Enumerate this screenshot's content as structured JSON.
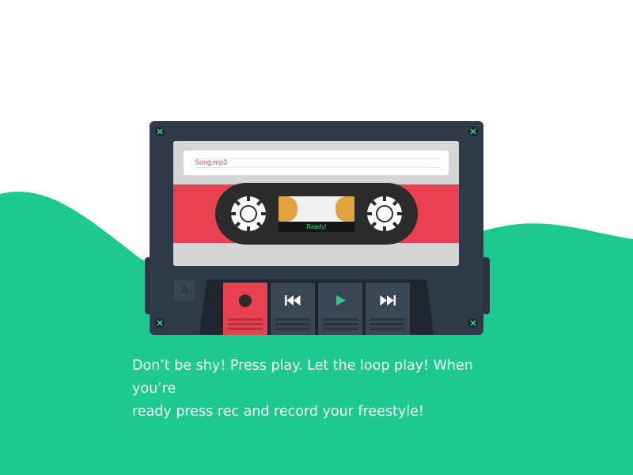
{
  "colors": {
    "background": "#ffffff",
    "wave": "#1dc98f",
    "cassette_body": "#2f3a48",
    "label_band": "#e94151",
    "tape": "#e3a240",
    "status_text": "#2dd47e",
    "record": "#e94151",
    "play_icon": "#2dc988"
  },
  "cassette": {
    "track_name": "Song.mp3",
    "status": "Ready!",
    "side_label": "A"
  },
  "controls": [
    {
      "name": "record",
      "icon": "record-icon"
    },
    {
      "name": "rewind",
      "icon": "rewind-icon"
    },
    {
      "name": "play",
      "icon": "play-icon"
    },
    {
      "name": "fast-forward",
      "icon": "fast-forward-icon"
    }
  ],
  "caption": {
    "line1": "Don’t be shy! Press play. Let the loop play! When you’re",
    "line2": "ready press rec and record your freestyle!"
  }
}
